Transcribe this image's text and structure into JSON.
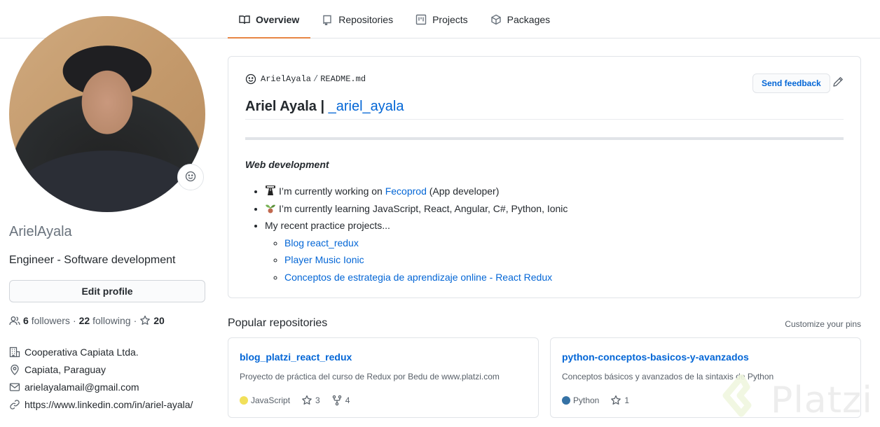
{
  "nav": {
    "tabs": [
      {
        "label": "Overview",
        "icon": "book-icon",
        "selected": true
      },
      {
        "label": "Repositories",
        "icon": "repo-icon",
        "selected": false
      },
      {
        "label": "Projects",
        "icon": "project-icon",
        "selected": false
      },
      {
        "label": "Packages",
        "icon": "package-icon",
        "selected": false
      }
    ]
  },
  "profile": {
    "username": "ArielAyala",
    "bio": "Engineer - Software development",
    "edit_label": "Edit profile",
    "followers_count": "6",
    "followers_label": "followers",
    "following_count": "22",
    "following_label": "following",
    "stars_count": "20",
    "separator": "·",
    "details": {
      "company": "Cooperativa Capiata Ltda.",
      "location": "Capiata, Paraguay",
      "email": "arielayalamail@gmail.com",
      "website": "https://www.linkedin.com/in/ariel-ayala/"
    }
  },
  "readme": {
    "path_user": "ArielAyala",
    "path_sep": "/",
    "path_file": "README.md",
    "feedback_label": "Send feedback",
    "heading_text": "Ariel Ayala | ",
    "heading_link": "_ariel_ayala",
    "subtitle": "Web development",
    "items": {
      "working_pre": "I’m currently working on ",
      "working_link": "Fecoprod",
      "working_post": " (App developer)",
      "learning": "I’m currently learning JavaScript, React, Angular, C#, Python, Ionic",
      "projects": "My recent practice projects...",
      "project_links": [
        "Blog react_redux",
        "Player Music Ionic",
        "Conceptos de estrategia de aprendizaje online - React Redux"
      ]
    }
  },
  "popular": {
    "title": "Popular repositories",
    "customize_label": "Customize your pins",
    "repos": [
      {
        "name": "blog_platzi_react_redux",
        "description": "Proyecto de práctica del curso de Redux por Bedu de www.platzi.com",
        "language": "JavaScript",
        "language_color": "#f1e05a",
        "stars": "3",
        "forks": "4"
      },
      {
        "name": "python-conceptos-basicos-y-avanzados",
        "description": "Conceptos básicos y avanzados de la sintaxis de Python",
        "language": "Python",
        "language_color": "#3572A5",
        "stars": "1"
      }
    ]
  },
  "watermark": {
    "text": "Platzi"
  }
}
